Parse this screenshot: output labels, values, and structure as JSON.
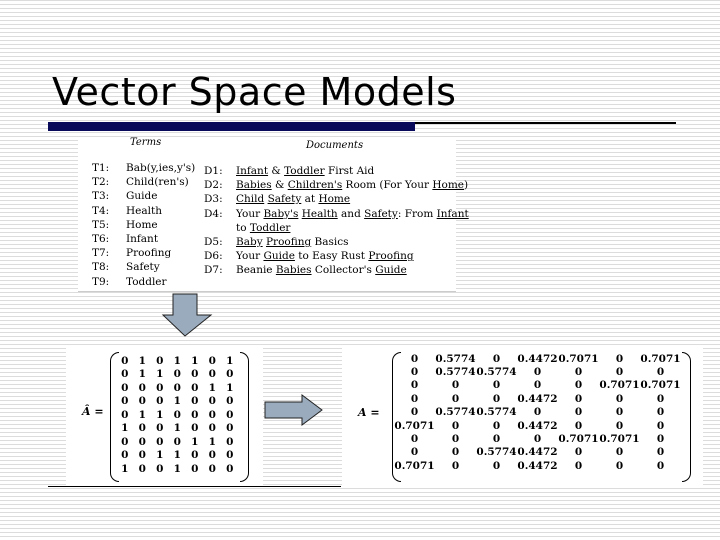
{
  "slide": {
    "title": "Vector Space Models"
  },
  "terms_table": {
    "terms_header": "Terms",
    "documents_header": "Documents",
    "terms": [
      {
        "id": "T1:",
        "label": "Bab(y,ies,y's)"
      },
      {
        "id": "T2:",
        "label": "Child(ren's)"
      },
      {
        "id": "T3:",
        "label": "Guide"
      },
      {
        "id": "T4:",
        "label": "Health"
      },
      {
        "id": "T5:",
        "label": "Home"
      },
      {
        "id": "T6:",
        "label": "Infant"
      },
      {
        "id": "T7:",
        "label": "Proofing"
      },
      {
        "id": "T8:",
        "label": "Safety"
      },
      {
        "id": "T9:",
        "label": "Toddler"
      }
    ],
    "documents": [
      {
        "id": "D1:",
        "parts": [
          [
            "Infant",
            true
          ],
          [
            " & ",
            false
          ],
          [
            "Toddler",
            true
          ],
          [
            " First Aid",
            false
          ]
        ]
      },
      {
        "id": "D2:",
        "parts": [
          [
            "Babies",
            true
          ],
          [
            " & ",
            false
          ],
          [
            "Children's",
            true
          ],
          [
            " Room (For Your ",
            false
          ],
          [
            "Home",
            true
          ],
          [
            ")",
            false
          ]
        ]
      },
      {
        "id": "D3:",
        "parts": [
          [
            "Child",
            true
          ],
          [
            " ",
            false
          ],
          [
            "Safety",
            true
          ],
          [
            " at ",
            false
          ],
          [
            "Home",
            true
          ]
        ]
      },
      {
        "id": "D4:",
        "parts": [
          [
            "Your ",
            false
          ],
          [
            "Baby's",
            true
          ],
          [
            " ",
            false
          ],
          [
            "Health",
            true
          ],
          [
            " and ",
            false
          ],
          [
            "Safety",
            true
          ],
          [
            ": From ",
            false
          ],
          [
            "Infant",
            true
          ]
        ]
      },
      {
        "id": "",
        "parts": [
          [
            "to ",
            false
          ],
          [
            "Toddler",
            true
          ]
        ]
      },
      {
        "id": "D5:",
        "parts": [
          [
            "Baby",
            true
          ],
          [
            " ",
            false
          ],
          [
            "Proofing",
            true
          ],
          [
            " Basics",
            false
          ]
        ]
      },
      {
        "id": "D6:",
        "parts": [
          [
            "Your ",
            false
          ],
          [
            "Guide",
            true
          ],
          [
            " to Easy Rust ",
            false
          ],
          [
            "Proofing",
            true
          ]
        ]
      },
      {
        "id": "D7:",
        "parts": [
          [
            "Beanie ",
            false
          ],
          [
            "Babies",
            true
          ],
          [
            " Collector's ",
            false
          ],
          [
            "Guide",
            true
          ]
        ]
      }
    ]
  },
  "binary_matrix": {
    "label": "Â =",
    "rows": [
      [
        "0",
        "1",
        "0",
        "1",
        "1",
        "0",
        "1"
      ],
      [
        "0",
        "1",
        "1",
        "0",
        "0",
        "0",
        "0"
      ],
      [
        "0",
        "0",
        "0",
        "0",
        "0",
        "1",
        "1"
      ],
      [
        "0",
        "0",
        "0",
        "1",
        "0",
        "0",
        "0"
      ],
      [
        "0",
        "1",
        "1",
        "0",
        "0",
        "0",
        "0"
      ],
      [
        "1",
        "0",
        "0",
        "1",
        "0",
        "0",
        "0"
      ],
      [
        "0",
        "0",
        "0",
        "0",
        "1",
        "1",
        "0"
      ],
      [
        "0",
        "0",
        "1",
        "1",
        "0",
        "0",
        "0"
      ],
      [
        "1",
        "0",
        "0",
        "1",
        "0",
        "0",
        "0"
      ]
    ]
  },
  "normalized_matrix": {
    "label": "A =",
    "rows": [
      [
        "0",
        "0.5774",
        "0",
        "0.4472",
        "0.7071",
        "0",
        "0.7071"
      ],
      [
        "0",
        "0.5774",
        "0.5774",
        "0",
        "0",
        "0",
        "0"
      ],
      [
        "0",
        "0",
        "0",
        "0",
        "0",
        "0.7071",
        "0.7071"
      ],
      [
        "0",
        "0",
        "0",
        "0.4472",
        "0",
        "0",
        "0"
      ],
      [
        "0",
        "0.5774",
        "0.5774",
        "0",
        "0",
        "0",
        "0"
      ],
      [
        "0.7071",
        "0",
        "0",
        "0.4472",
        "0",
        "0",
        "0"
      ],
      [
        "0",
        "0",
        "0",
        "0",
        "0.7071",
        "0.7071",
        "0"
      ],
      [
        "0",
        "0",
        "0.5774",
        "0.4472",
        "0",
        "0",
        "0"
      ],
      [
        "0.7071",
        "0",
        "0",
        "0.4472",
        "0",
        "0",
        "0"
      ]
    ]
  },
  "icons": {
    "down_arrow": "arrow-down",
    "right_arrow": "arrow-right",
    "arrow_fill": "#9aabbd"
  },
  "colors": {
    "accent_bar": "#0a0a5a"
  }
}
